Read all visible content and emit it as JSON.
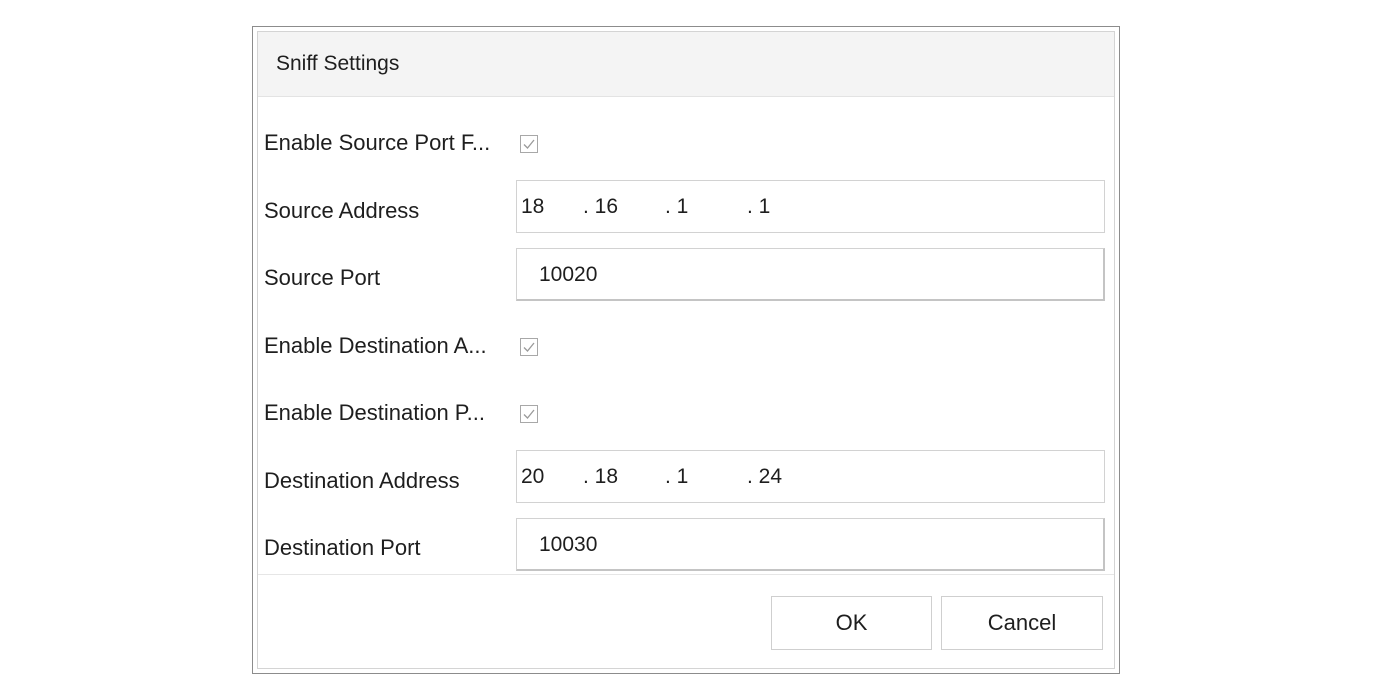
{
  "dialog": {
    "title": "Sniff Settings"
  },
  "rows": {
    "enable_source_port": {
      "label": "Enable Source Port F...",
      "checked": true
    },
    "source_address": {
      "label": "Source Address",
      "octets": [
        "18",
        ". 16",
        ". 1",
        ". 1"
      ]
    },
    "source_port": {
      "label": "Source Port",
      "value": "10020"
    },
    "enable_destination_address": {
      "label": "Enable Destination A...",
      "checked": true
    },
    "enable_destination_port": {
      "label": "Enable Destination P...",
      "checked": true
    },
    "destination_address": {
      "label": "Destination Address",
      "octets": [
        "20",
        ". 18",
        ". 1",
        ". 24"
      ]
    },
    "destination_port": {
      "label": "Destination Port",
      "value": "10030"
    }
  },
  "buttons": {
    "ok_label": "OK",
    "cancel_label": "Cancel"
  },
  "colors": {
    "check_mark": "#9a9a9a",
    "border": "#d2d2d2",
    "title_background": "#f4f4f4"
  },
  "icons": {
    "checkbox": "checkmark-icon"
  }
}
